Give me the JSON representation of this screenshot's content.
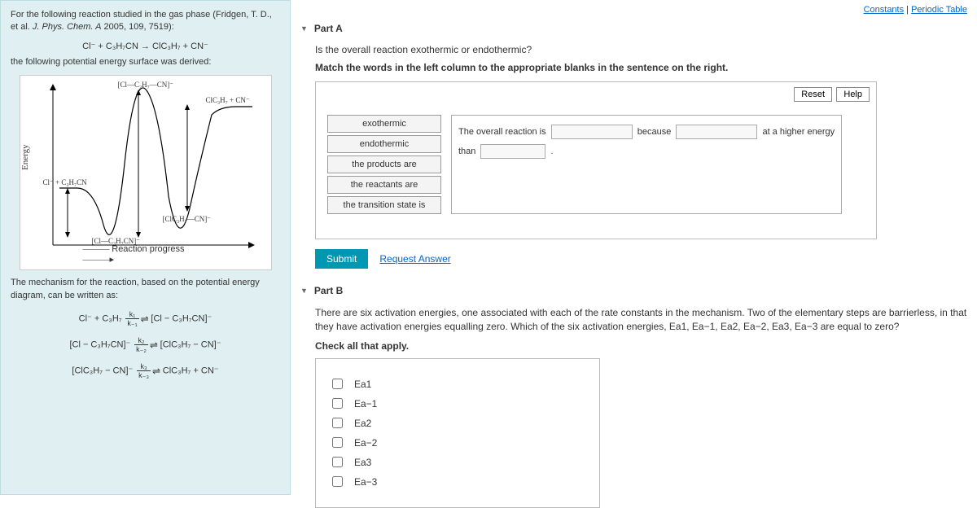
{
  "links": {
    "constants": "Constants",
    "periodic": "Periodic Table"
  },
  "left": {
    "intro1": "For the following reaction studied in the gas phase (Fridgen, T. D., et al. ",
    "intro_journal": "J. Phys. Chem. A",
    "intro_cite": " 2005, 109, 7519):",
    "reaction": "Cl⁻ + C₃H₇CN → ClC₃H₇ + CN⁻",
    "intro2": "the following potential energy surface was derived:",
    "yaxis": "Energy",
    "xaxis": "Reaction progress",
    "lbl_top": "[Cl—C₃H₇—CN]⁻",
    "lbl_left": "Cl⁻ + C₃H₇CN",
    "lbl_well1": "[Cl—C₃H₇CN]⁻",
    "lbl_well2": "[ClC₃H₇—CN]⁻",
    "lbl_right": "ClC₃H₇ + CN⁻",
    "mech_text": "The mechanism for the reaction, based on the potential energy diagram, can be written as:",
    "mech1_l": "Cl⁻ + C₃H₇",
    "mech1_r": "[Cl − C₃H₇CN]⁻",
    "mech2_l": "[Cl − C₃H₇CN]⁻",
    "mech2_r": "[ClC₃H₇ − CN]⁻",
    "mech3_l": "[ClC₃H₇ − CN]⁻",
    "mech3_r": "ClC₃H₇ + CN⁻",
    "k1n": "k₁",
    "k1d": "k₋₁",
    "k2n": "k₂",
    "k2d": "k₋₂",
    "k3n": "k₃",
    "k3d": "k₋₃"
  },
  "partA": {
    "title": "Part A",
    "q1": "Is the overall reaction exothermic or endothermic?",
    "q2": "Match the words in the left column to the appropriate blanks in the sentence on the right.",
    "reset": "Reset",
    "help": "Help",
    "words": {
      "w1": "exothermic",
      "w2": "endothermic",
      "w3": "the products are",
      "w4": "the reactants are",
      "w5": "the transition state is"
    },
    "sentence": {
      "s1": "The overall reaction is",
      "s2": "because",
      "s3": "at a higher energy",
      "s4": "than",
      "s5": "."
    },
    "submit": "Submit",
    "request": "Request Answer"
  },
  "partB": {
    "title": "Part B",
    "desc": "There are six activation energies, one associated with each of the rate constants in the mechanism. Two of the elementary steps are barrierless, in that they have activation energies equalling zero. Which of the six activation energies, Ea1, Ea−1, Ea2, Ea−2, Ea3, Ea−3 are equal to zero?",
    "check": "Check all that apply.",
    "opts": {
      "o1": "Ea1",
      "o2": "Ea−1",
      "o3": "Ea2",
      "o4": "Ea−2",
      "o5": "Ea3",
      "o6": "Ea−3"
    }
  }
}
